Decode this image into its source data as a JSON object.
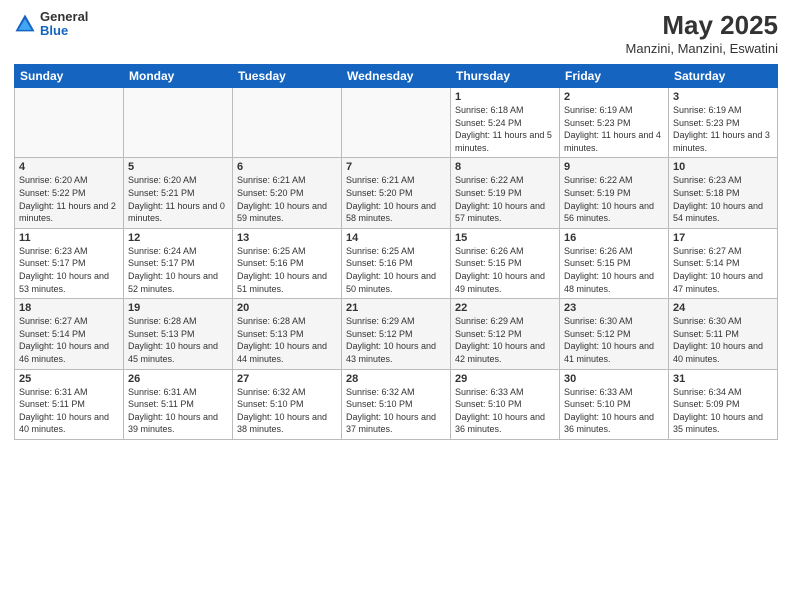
{
  "header": {
    "logo_general": "General",
    "logo_blue": "Blue",
    "title": "May 2025",
    "subtitle": "Manzini, Manzini, Eswatini"
  },
  "days_of_week": [
    "Sunday",
    "Monday",
    "Tuesday",
    "Wednesday",
    "Thursday",
    "Friday",
    "Saturday"
  ],
  "weeks": [
    [
      {
        "day": "",
        "info": ""
      },
      {
        "day": "",
        "info": ""
      },
      {
        "day": "",
        "info": ""
      },
      {
        "day": "",
        "info": ""
      },
      {
        "day": "1",
        "info": "Sunrise: 6:18 AM\nSunset: 5:24 PM\nDaylight: 11 hours\nand 5 minutes."
      },
      {
        "day": "2",
        "info": "Sunrise: 6:19 AM\nSunset: 5:23 PM\nDaylight: 11 hours\nand 4 minutes."
      },
      {
        "day": "3",
        "info": "Sunrise: 6:19 AM\nSunset: 5:23 PM\nDaylight: 11 hours\nand 3 minutes."
      }
    ],
    [
      {
        "day": "4",
        "info": "Sunrise: 6:20 AM\nSunset: 5:22 PM\nDaylight: 11 hours\nand 2 minutes."
      },
      {
        "day": "5",
        "info": "Sunrise: 6:20 AM\nSunset: 5:21 PM\nDaylight: 11 hours\nand 0 minutes."
      },
      {
        "day": "6",
        "info": "Sunrise: 6:21 AM\nSunset: 5:20 PM\nDaylight: 10 hours\nand 59 minutes."
      },
      {
        "day": "7",
        "info": "Sunrise: 6:21 AM\nSunset: 5:20 PM\nDaylight: 10 hours\nand 58 minutes."
      },
      {
        "day": "8",
        "info": "Sunrise: 6:22 AM\nSunset: 5:19 PM\nDaylight: 10 hours\nand 57 minutes."
      },
      {
        "day": "9",
        "info": "Sunrise: 6:22 AM\nSunset: 5:19 PM\nDaylight: 10 hours\nand 56 minutes."
      },
      {
        "day": "10",
        "info": "Sunrise: 6:23 AM\nSunset: 5:18 PM\nDaylight: 10 hours\nand 54 minutes."
      }
    ],
    [
      {
        "day": "11",
        "info": "Sunrise: 6:23 AM\nSunset: 5:17 PM\nDaylight: 10 hours\nand 53 minutes."
      },
      {
        "day": "12",
        "info": "Sunrise: 6:24 AM\nSunset: 5:17 PM\nDaylight: 10 hours\nand 52 minutes."
      },
      {
        "day": "13",
        "info": "Sunrise: 6:25 AM\nSunset: 5:16 PM\nDaylight: 10 hours\nand 51 minutes."
      },
      {
        "day": "14",
        "info": "Sunrise: 6:25 AM\nSunset: 5:16 PM\nDaylight: 10 hours\nand 50 minutes."
      },
      {
        "day": "15",
        "info": "Sunrise: 6:26 AM\nSunset: 5:15 PM\nDaylight: 10 hours\nand 49 minutes."
      },
      {
        "day": "16",
        "info": "Sunrise: 6:26 AM\nSunset: 5:15 PM\nDaylight: 10 hours\nand 48 minutes."
      },
      {
        "day": "17",
        "info": "Sunrise: 6:27 AM\nSunset: 5:14 PM\nDaylight: 10 hours\nand 47 minutes."
      }
    ],
    [
      {
        "day": "18",
        "info": "Sunrise: 6:27 AM\nSunset: 5:14 PM\nDaylight: 10 hours\nand 46 minutes."
      },
      {
        "day": "19",
        "info": "Sunrise: 6:28 AM\nSunset: 5:13 PM\nDaylight: 10 hours\nand 45 minutes."
      },
      {
        "day": "20",
        "info": "Sunrise: 6:28 AM\nSunset: 5:13 PM\nDaylight: 10 hours\nand 44 minutes."
      },
      {
        "day": "21",
        "info": "Sunrise: 6:29 AM\nSunset: 5:12 PM\nDaylight: 10 hours\nand 43 minutes."
      },
      {
        "day": "22",
        "info": "Sunrise: 6:29 AM\nSunset: 5:12 PM\nDaylight: 10 hours\nand 42 minutes."
      },
      {
        "day": "23",
        "info": "Sunrise: 6:30 AM\nSunset: 5:12 PM\nDaylight: 10 hours\nand 41 minutes."
      },
      {
        "day": "24",
        "info": "Sunrise: 6:30 AM\nSunset: 5:11 PM\nDaylight: 10 hours\nand 40 minutes."
      }
    ],
    [
      {
        "day": "25",
        "info": "Sunrise: 6:31 AM\nSunset: 5:11 PM\nDaylight: 10 hours\nand 40 minutes."
      },
      {
        "day": "26",
        "info": "Sunrise: 6:31 AM\nSunset: 5:11 PM\nDaylight: 10 hours\nand 39 minutes."
      },
      {
        "day": "27",
        "info": "Sunrise: 6:32 AM\nSunset: 5:10 PM\nDaylight: 10 hours\nand 38 minutes."
      },
      {
        "day": "28",
        "info": "Sunrise: 6:32 AM\nSunset: 5:10 PM\nDaylight: 10 hours\nand 37 minutes."
      },
      {
        "day": "29",
        "info": "Sunrise: 6:33 AM\nSunset: 5:10 PM\nDaylight: 10 hours\nand 36 minutes."
      },
      {
        "day": "30",
        "info": "Sunrise: 6:33 AM\nSunset: 5:10 PM\nDaylight: 10 hours\nand 36 minutes."
      },
      {
        "day": "31",
        "info": "Sunrise: 6:34 AM\nSunset: 5:09 PM\nDaylight: 10 hours\nand 35 minutes."
      }
    ]
  ]
}
